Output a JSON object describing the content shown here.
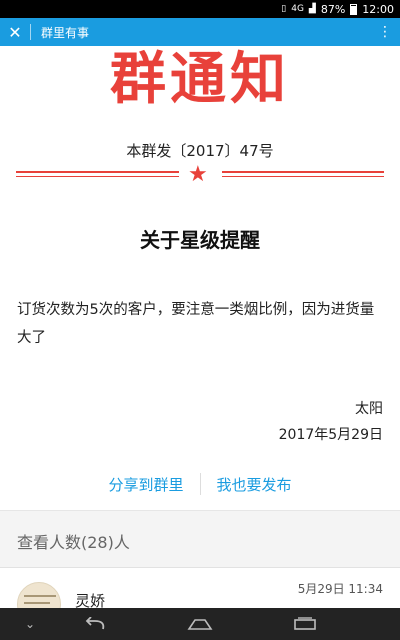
{
  "status_bar": {
    "signal_4g": "4G",
    "battery": "87%",
    "time": "12:00"
  },
  "title_bar": {
    "title": "群里有事"
  },
  "notice": {
    "banner": "群通知",
    "doc_number": "本群发〔2017〕47号",
    "title": "关于星级提醒",
    "body": "订货次数为5次的客户，要注意一类烟比例，因为进货量大了",
    "signer": "太阳",
    "date": "2017年5月29日"
  },
  "actions": {
    "share": "分享到群里",
    "publish": "我也要发布"
  },
  "viewers": {
    "heading": "查看人数(28)人",
    "list": [
      {
        "name": "灵娇",
        "time": "5月29日 11:34"
      }
    ]
  },
  "colors": {
    "accent": "#1a9ce0",
    "red": "#e8413a"
  }
}
